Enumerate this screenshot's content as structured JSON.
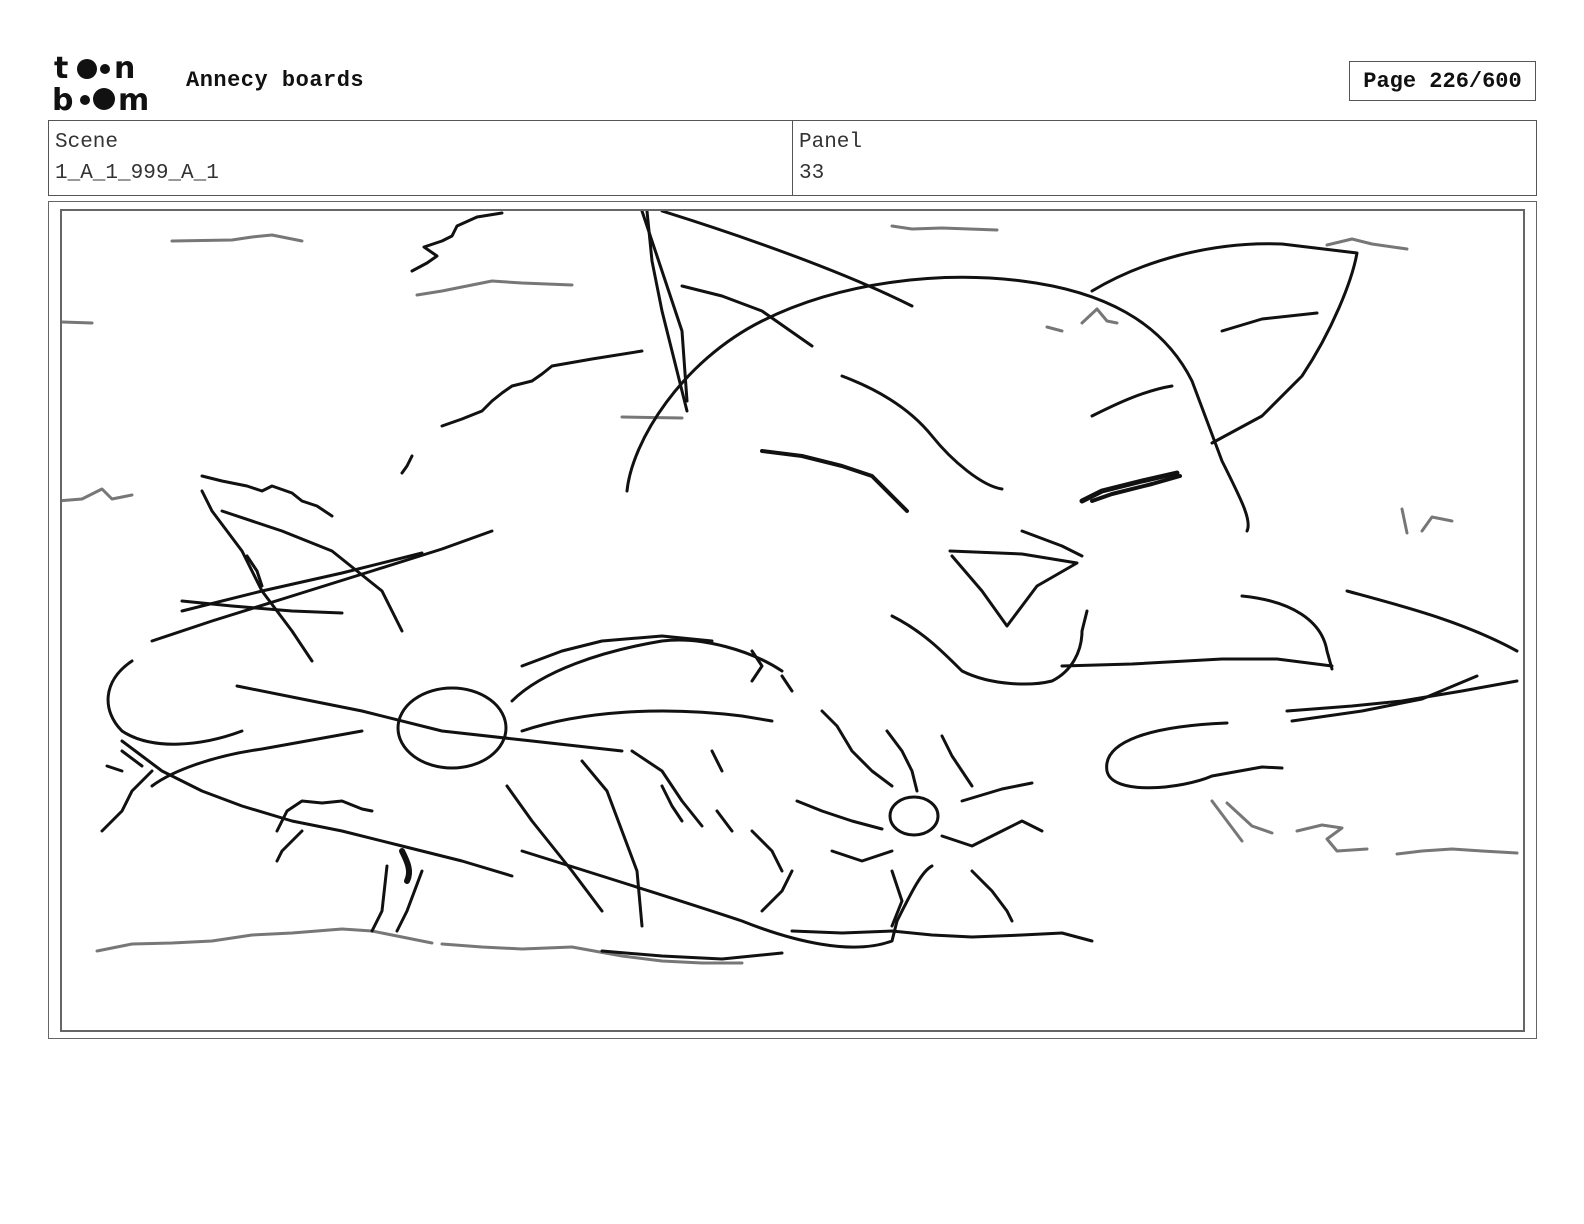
{
  "header": {
    "logo_text": "toon boom",
    "project_title": "Annecy boards",
    "page_indicator": "Page 226/600"
  },
  "info": {
    "scene_label": "Scene",
    "scene_value": "1_A_1_999_A_1",
    "panel_label": "Panel",
    "panel_value": "33"
  },
  "panel_image": {
    "description_icon": "sketch-fox-sleeping-with-flower"
  }
}
